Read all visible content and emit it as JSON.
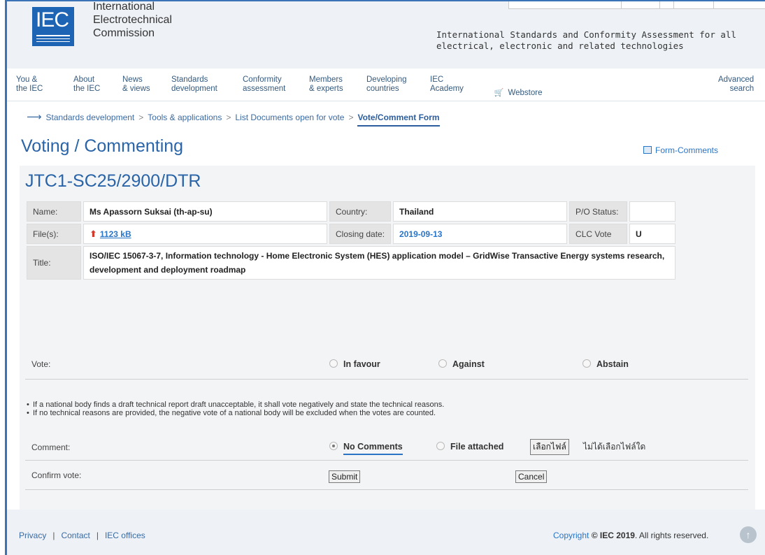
{
  "header": {
    "org_line1": "International",
    "org_line2": "Electrotechnical",
    "org_line3": "Commission",
    "logo_text": "IEC",
    "tagline1": "International Standards and Conformity Assessment for all",
    "tagline2": "electrical, electronic and related technologies"
  },
  "nav": {
    "items": [
      "You &\nthe IEC",
      "About\nthe IEC",
      "News\n& views",
      "Standards\ndevelopment",
      "Conformity\nassessment",
      "Members\n& experts",
      "Developing\ncountries",
      "IEC\nAcademy"
    ],
    "webstore": "Webstore",
    "advanced_search": "Advanced\nsearch"
  },
  "breadcrumb": {
    "items": [
      "Standards development",
      "Tools & applications",
      "List Documents open for vote"
    ],
    "current": "Vote/Comment Form",
    "separator": ">"
  },
  "page": {
    "title": "Voting / Commenting",
    "form_comments": "Form-Comments"
  },
  "doc": {
    "id": "JTC1-SC25/2900/DTR",
    "name_label": "Name:",
    "name_value": "Ms Apassorn Suksai (th-ap-su)",
    "country_label": "Country:",
    "country_value": "Thailand",
    "po_label": "P/O Status:",
    "po_value": "",
    "files_label": "File(s):",
    "file_size": "1123 kB",
    "closing_label": "Closing date:",
    "closing_value": "2019-09-13",
    "clc_label": "CLC Vote",
    "clc_value": "U",
    "title_label": "Title:",
    "title_value": "ISO/IEC 15067-3-7, Information technology - Home Electronic System (HES) application model – GridWise Transactive Energy systems research, development and deployment roadmap"
  },
  "vote": {
    "label": "Vote:",
    "options": [
      "In favour",
      "Against",
      "Abstain"
    ],
    "notes": [
      "If a national body finds a draft technical report draft unacceptable, it shall vote negatively and state the technical reasons.",
      "If no technical reasons are provided, the negative vote of a national body will be excluded when the votes are counted."
    ],
    "comment_label": "Comment:",
    "comment_options": [
      "No Comments",
      "File attached"
    ],
    "comment_selected": "No Comments",
    "file_button": "เลือกไฟล์",
    "file_status": "ไม่ได้เลือกไฟล์ใด",
    "confirm_label": "Confirm vote:",
    "submit": "Submit",
    "cancel": "Cancel"
  },
  "footer": {
    "links": [
      "Privacy",
      "Contact",
      "IEC offices"
    ],
    "copyright_prefix": "Copyright",
    "copyright_main": "© IEC 2019",
    "copyright_suffix": ". All rights reserved."
  },
  "colors": {
    "brand_blue": "#1e64b4",
    "link_blue": "#2a74c6",
    "header_bg": "#eef2f6"
  }
}
